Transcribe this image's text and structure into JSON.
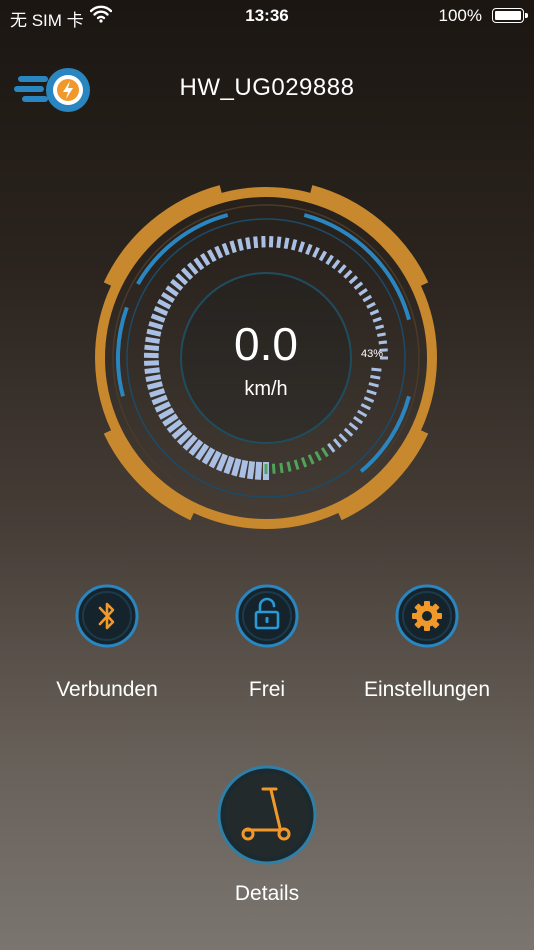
{
  "status_bar": {
    "carrier": "无 SIM 卡",
    "time": "13:36",
    "battery": "100%",
    "battery_level": 1.0
  },
  "header": {
    "device_name": "HW_UG029888"
  },
  "gauge": {
    "speed": "0.0",
    "unit": "km/h",
    "battery_percent_label": "43%",
    "battery_level": 0.43
  },
  "actions": [
    {
      "label": "Verbunden",
      "icon": "bluetooth-icon"
    },
    {
      "label": "Frei",
      "icon": "unlock-icon"
    },
    {
      "label": "Einstellungen",
      "icon": "gear-icon"
    }
  ],
  "details": {
    "label": "Details",
    "icon": "scooter-icon"
  },
  "colors": {
    "accent_orange": "#c7882e",
    "accent_blue": "#2a86c0",
    "segment_blue": "#a9c0e4",
    "battery_green": "#4fa35a",
    "icon_orange": "#f0982a"
  }
}
